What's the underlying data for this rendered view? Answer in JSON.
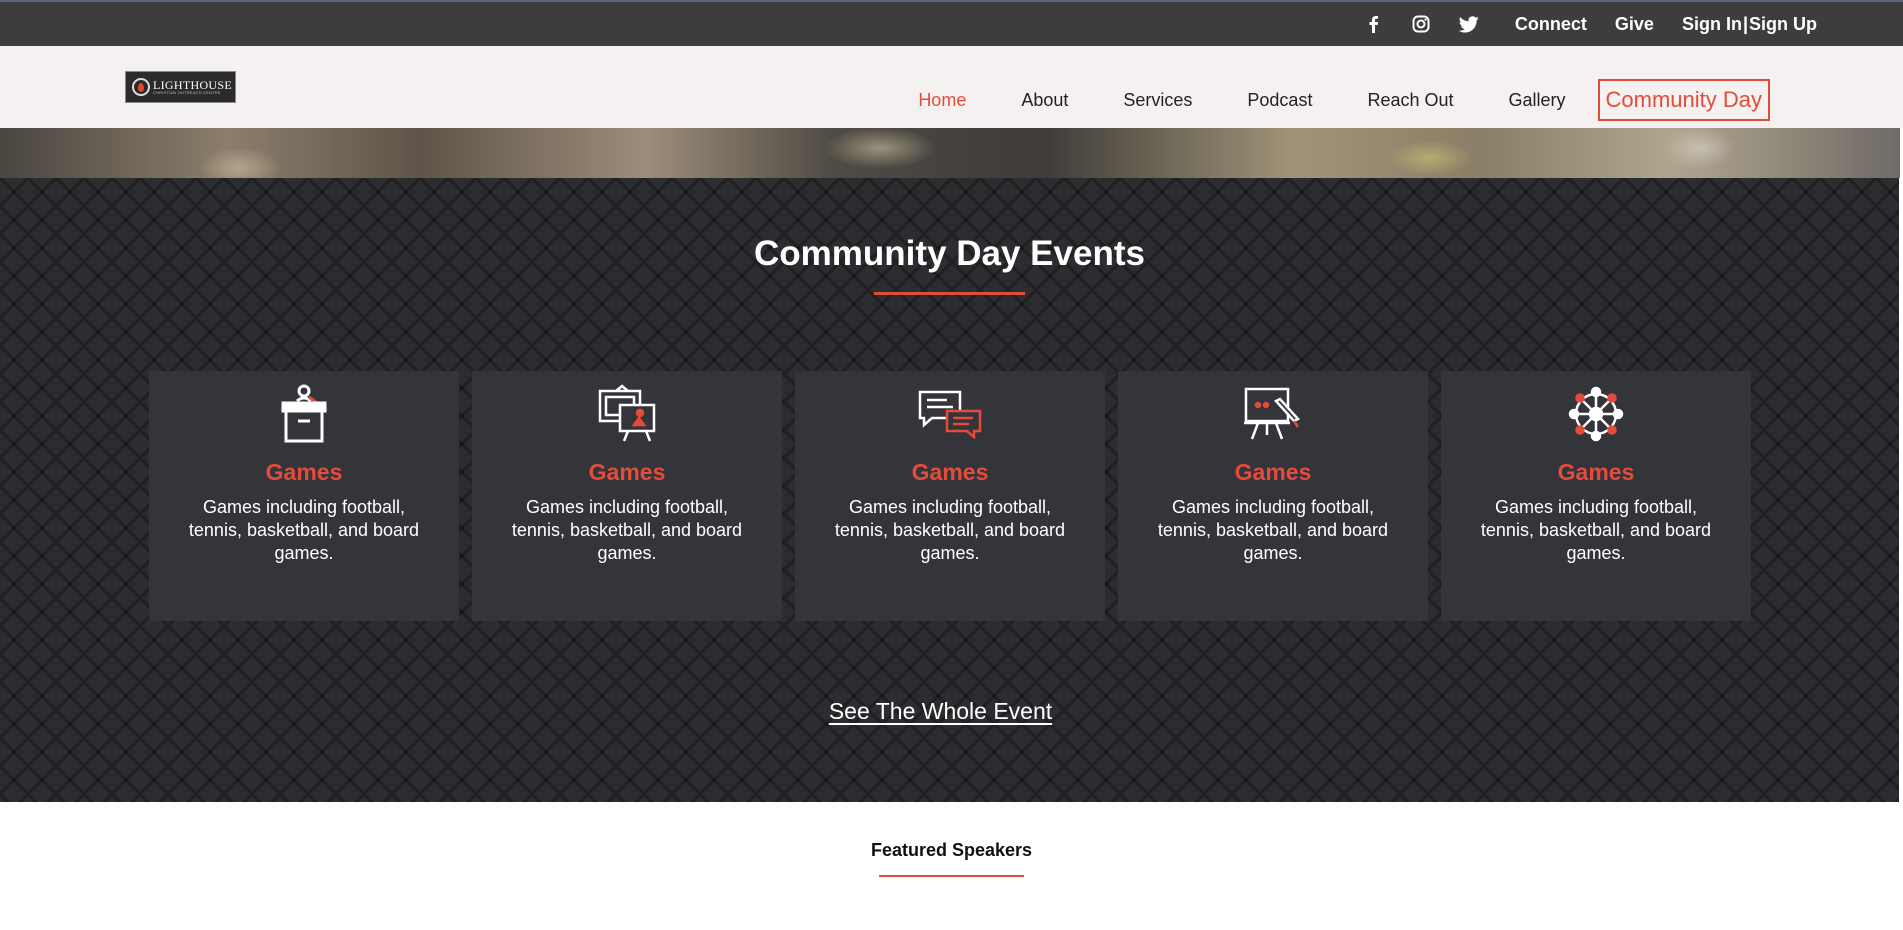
{
  "topbar": {
    "social": [
      {
        "name": "facebook-icon"
      },
      {
        "name": "instagram-icon"
      },
      {
        "name": "twitter-icon"
      }
    ],
    "connect_label": "Connect",
    "give_label": "Give",
    "sign_in_label": "Sign In",
    "separator": "|",
    "sign_up_label": "Sign Up"
  },
  "logo": {
    "name": "LIGHTHOUSE",
    "subtitle": "CHRISTIAN OUTREACH CENTRE"
  },
  "nav": {
    "items": [
      "Home",
      "About",
      "Services",
      "Podcast",
      "Reach Out",
      "Gallery"
    ],
    "active": "Home",
    "cta_label": "Community Day"
  },
  "colors": {
    "accent": "#e34c3b",
    "topbar_bg": "#3d3d3f",
    "nav_bg": "#f4f1f0",
    "section_bg": "#2c2d31",
    "card_bg": "#34353b"
  },
  "events": {
    "title": "Community Day Events",
    "cards": [
      {
        "icon": "podium-icon",
        "title": "Games",
        "description": "Games including football, tennis, basketball, and board games."
      },
      {
        "icon": "presentation-board-icon",
        "title": "Games",
        "description": "Games including football, tennis, basketball, and board games."
      },
      {
        "icon": "chat-bubbles-icon",
        "title": "Games",
        "description": "Games including football, tennis, basketball, and board games."
      },
      {
        "icon": "easel-icon",
        "title": "Games",
        "description": "Games including football, tennis, basketball, and board games."
      },
      {
        "icon": "network-icon",
        "title": "Games",
        "description": "Games including football, tennis, basketball, and board games."
      }
    ],
    "see_all_label": "See The Whole Event"
  },
  "featured": {
    "title": "Featured Speakers"
  }
}
